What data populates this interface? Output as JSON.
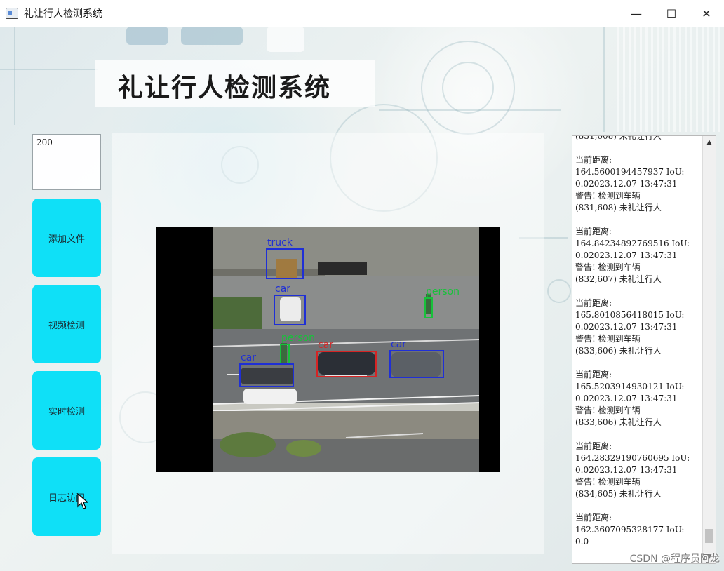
{
  "window": {
    "title": "礼让行人检测系统",
    "minimize_icon": "—",
    "maximize_icon": "☐",
    "close_icon": "✕"
  },
  "header": {
    "title": "礼让行人检测系统"
  },
  "input": {
    "value": "200"
  },
  "buttons": [
    {
      "label": "添加文件"
    },
    {
      "label": "视频检测"
    },
    {
      "label": "实时检测"
    },
    {
      "label": "日志访问"
    }
  ],
  "detections": [
    {
      "label": "truck",
      "color": "#1f2fd6"
    },
    {
      "label": "car",
      "color": "#1f2fd6"
    },
    {
      "label": "person",
      "color": "#17c23a"
    },
    {
      "label": "person",
      "color": "#17c23a"
    },
    {
      "label": "car",
      "color": "#d62424"
    },
    {
      "label": "car",
      "color": "#1f2fd6"
    },
    {
      "label": "car",
      "color": "#1f2fd6"
    }
  ],
  "log": {
    "text": "(831,608) 未礼让行人\n\n当前距离:\n164.5600194457937 IoU:\n0.02023.12.07 13:47:31\n警告! 检测到车辆\n(831,608) 未礼让行人\n\n当前距离:\n164.84234892769516 IoU:\n0.02023.12.07 13:47:31\n警告! 检测到车辆\n(832,607) 未礼让行人\n\n当前距离:\n165.8010856418015 IoU:\n0.02023.12.07 13:47:31\n警告! 检测到车辆\n(833,606) 未礼让行人\n\n当前距离:\n165.5203914930121 IoU:\n0.02023.12.07 13:47:31\n警告! 检测到车辆\n(833,606) 未礼让行人\n\n当前距离:\n164.28329190760695 IoU:\n0.02023.12.07 13:47:31\n警告! 检测到车辆\n(834,605) 未礼让行人\n\n当前距离:\n162.3607095328177 IoU:\n0.0"
  },
  "watermark": "CSDN @程序员阿龙"
}
